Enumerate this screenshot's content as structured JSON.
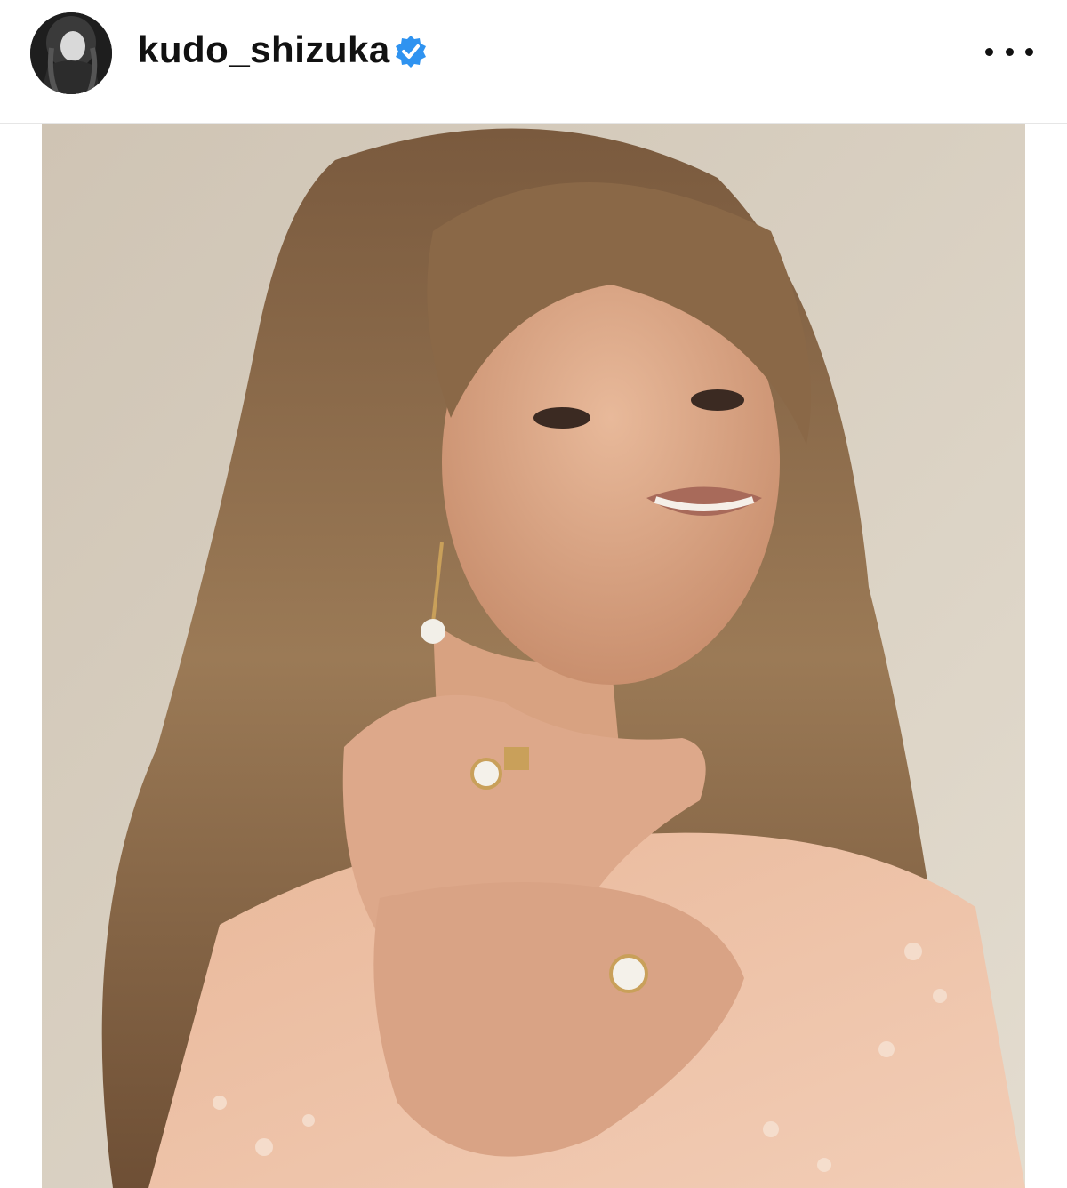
{
  "post_header": {
    "username": "kudo_shizuka",
    "avatar_icon": "profile-avatar",
    "verified_icon": "verified-badge-icon",
    "more_icon": "more-options-icon"
  },
  "post_image": {
    "subject": "portrait-photo"
  },
  "colors": {
    "verified_blue": "#2f93f0",
    "text": "#111111",
    "divider": "#e6e6e6"
  }
}
